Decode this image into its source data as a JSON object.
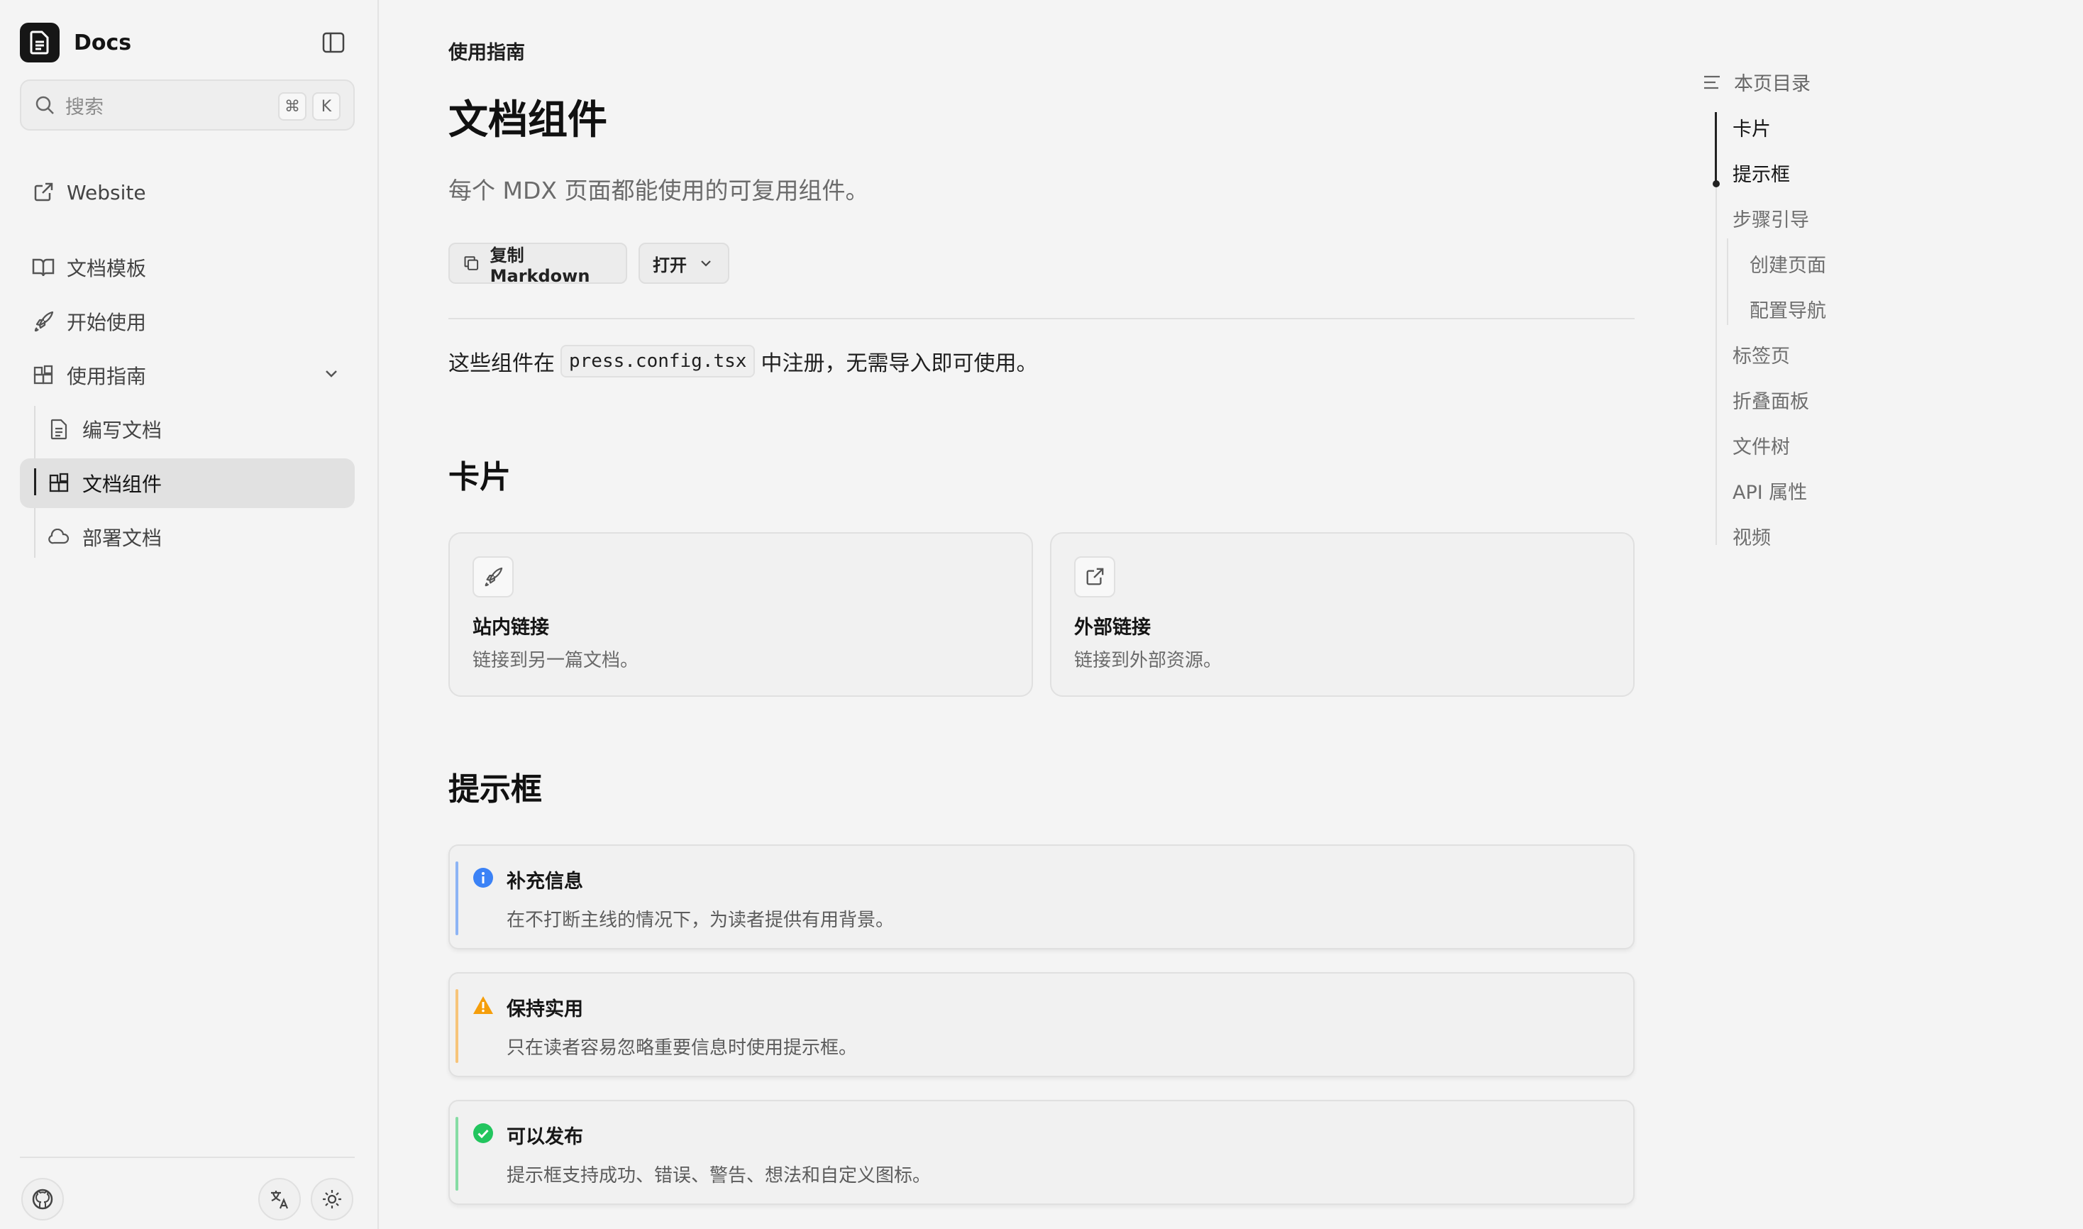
{
  "app": {
    "name": "Docs"
  },
  "sidebar": {
    "search_placeholder": "搜索",
    "shortcut_keys": [
      "⌘",
      "K"
    ],
    "website_link": "Website",
    "items": [
      {
        "label": "文档模板",
        "icon": "book-open-icon"
      },
      {
        "label": "开始使用",
        "icon": "rocket-icon"
      },
      {
        "label": "使用指南",
        "icon": "blocks-icon",
        "expanded": true
      }
    ],
    "sub_items": [
      {
        "label": "编写文档",
        "icon": "file-text-icon"
      },
      {
        "label": "文档组件",
        "icon": "blocks-icon",
        "active": true
      },
      {
        "label": "部署文档",
        "icon": "cloud-icon"
      }
    ]
  },
  "page": {
    "breadcrumb": "使用指南",
    "title": "文档组件",
    "subtitle": "每个 MDX 页面都能使用的可复用组件。",
    "copy_button": "复制 Markdown",
    "open_button": "打开",
    "intro_before": "这些组件在",
    "intro_code": "press.config.tsx",
    "intro_after": "中注册，无需导入即可使用。",
    "cards_heading": "卡片",
    "cards": [
      {
        "title": "站内链接",
        "desc": "链接到另一篇文档。",
        "icon": "rocket-icon"
      },
      {
        "title": "外部链接",
        "desc": "链接到外部资源。",
        "icon": "external-link-icon"
      }
    ],
    "callouts_heading": "提示框",
    "callouts": [
      {
        "title": "补充信息",
        "body": "在不打断主线的情况下，为读者提供有用背景。",
        "type": "info",
        "color": "#3b82f6"
      },
      {
        "title": "保持实用",
        "body": "只在读者容易忽略重要信息时使用提示框。",
        "type": "warning",
        "color": "#f59e0b"
      },
      {
        "title": "可以发布",
        "body": "提示框支持成功、错误、警告、想法和自定义图标。",
        "type": "success",
        "color": "#22c55e"
      }
    ]
  },
  "toc": {
    "heading": "本页目录",
    "items": [
      "卡片",
      "提示框",
      "步骤引导",
      "创建页面",
      "配置导航",
      "标签页",
      "折叠面板",
      "文件树",
      "API 属性",
      "视频"
    ]
  },
  "colors": {
    "accent": "#151515",
    "info": "#3b82f6",
    "warning": "#f59e0b",
    "success": "#22c55e"
  }
}
